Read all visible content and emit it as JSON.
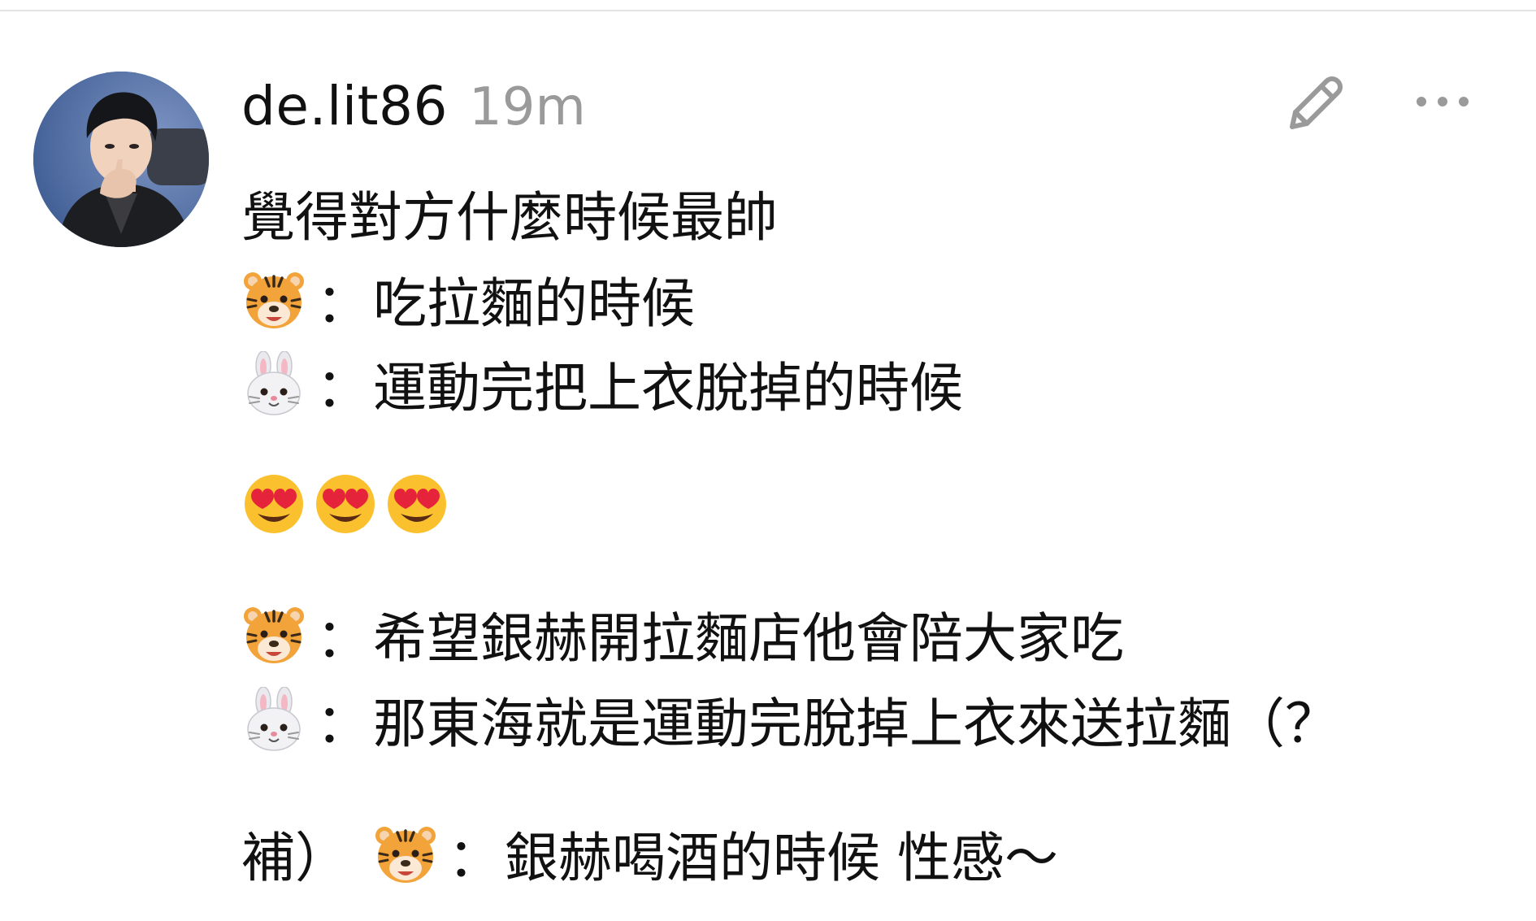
{
  "post": {
    "username": "de.lit86",
    "timestamp": "19m",
    "avatar_icon": "user-avatar-photo",
    "edit_icon": "pencil-icon",
    "more_icon": "ellipsis-icon",
    "lines": [
      {
        "text": "覺得對方什麼時候最帥"
      },
      {
        "emoji": "tiger-face",
        "colon": "：",
        "text": "吃拉麵的時候"
      },
      {
        "emoji": "rabbit-face",
        "colon": "：",
        "text": "運動完把上衣脫掉的時候"
      },
      {
        "emojis": [
          "heart-eyes-face",
          "heart-eyes-face",
          "heart-eyes-face"
        ]
      },
      {
        "emoji": "tiger-face",
        "colon": "：",
        "text": "希望銀赫開拉麵店他會陪大家吃"
      },
      {
        "emoji": "rabbit-face",
        "colon": "：",
        "text": "那東海就是運動完脫掉上衣來送拉麵（？"
      },
      {
        "prefix": "補）",
        "emoji": "tiger-face",
        "colon": "：",
        "text": "銀赫喝酒的時候 性感～"
      }
    ]
  },
  "colors": {
    "text": "#111111",
    "timestamp": "#9a9a9a",
    "icon": "#9a9a9a",
    "divider": "#e4e4e4"
  }
}
